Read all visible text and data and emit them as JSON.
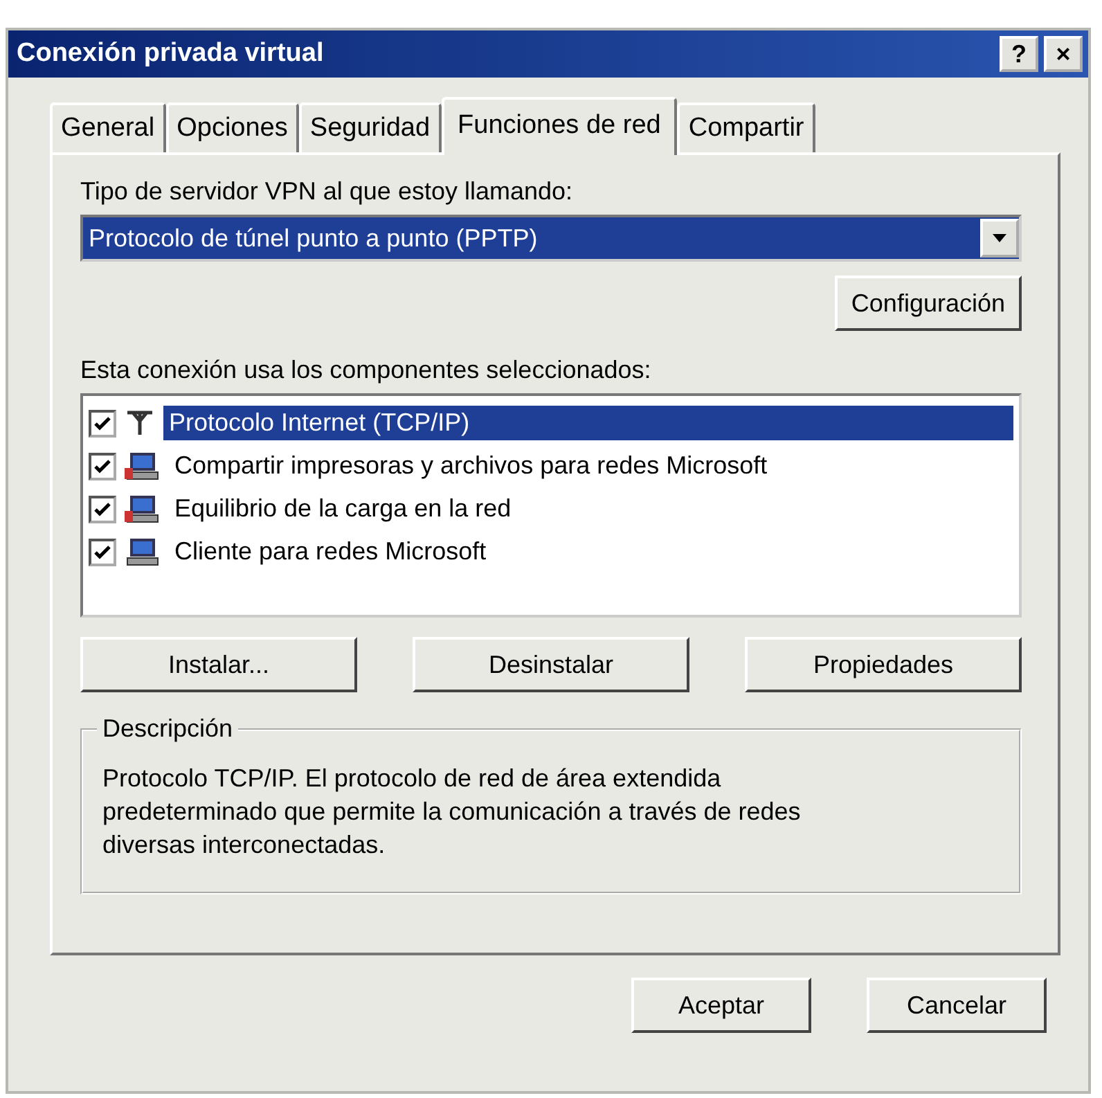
{
  "window": {
    "title": "Conexión privada virtual",
    "title_buttons": [
      "?",
      "×"
    ]
  },
  "tabs": [
    {
      "label": "General",
      "selected": false
    },
    {
      "label": "Opciones",
      "selected": false
    },
    {
      "label": "Seguridad",
      "selected": false
    },
    {
      "label": "Funciones de red",
      "selected": true
    },
    {
      "label": "Compartir",
      "selected": false
    }
  ],
  "server_type": {
    "label": "Tipo de servidor VPN al que estoy llamando:",
    "value": "Protocolo de túnel punto a punto (PPTP)",
    "button": "Configuración"
  },
  "components": {
    "label": "Esta conexión usa los componentes seleccionados:",
    "items": [
      {
        "label": "Protocolo Internet (TCP/IP)",
        "checked": true,
        "selected": true,
        "kind": "protocol"
      },
      {
        "label": "Compartir impresoras y archivos para redes Microsoft",
        "checked": true,
        "selected": false,
        "kind": "service"
      },
      {
        "label": "Equilibrio de la carga en la red",
        "checked": true,
        "selected": false,
        "kind": "service"
      },
      {
        "label": "Cliente para redes Microsoft",
        "checked": true,
        "selected": false,
        "kind": "client"
      }
    ],
    "buttons": [
      "Instalar...",
      "Desinstalar",
      "Propiedades"
    ]
  },
  "description": {
    "title": "Descripción",
    "text": "Protocolo TCP/IP. El protocolo de red de área extendida predeterminado que permite la comunicación a través de redes diversas interconectadas."
  },
  "buttons": [
    "Aceptar",
    "Cancelar"
  ]
}
